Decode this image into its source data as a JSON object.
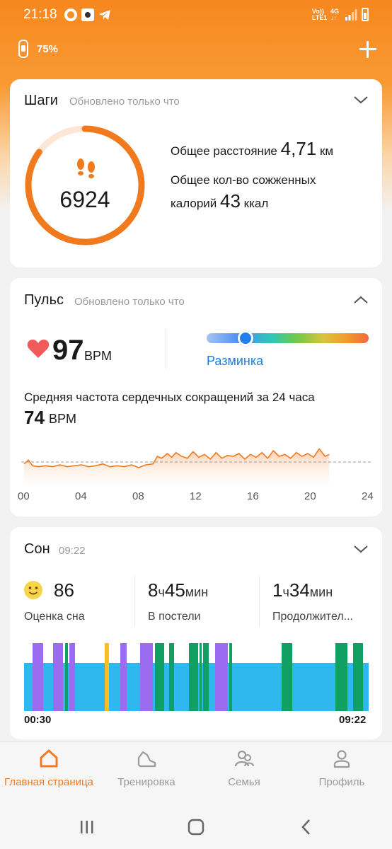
{
  "status_bar": {
    "time": "21:18",
    "net_top": "Vo))",
    "net_bottom": "LTE1",
    "g_top": "4G",
    "g_bottom": "↓↑"
  },
  "device": {
    "battery": "75%"
  },
  "steps": {
    "title": "Шаги",
    "updated": "Обновлено только что",
    "value": "6924",
    "progress": 0.85,
    "distance_label": "Общее расстояние",
    "distance_value": "4,71",
    "distance_unit": "км",
    "calories_label_line1": "Общее кол-во сожженных",
    "calories_label_line2": "калорий",
    "calories_value": "43",
    "calories_unit": "ккал"
  },
  "pulse": {
    "title": "Пульс",
    "updated": "Обновлено только что",
    "current_value": "97",
    "current_unit": "BPM",
    "zone_label": "Разминка",
    "zone_position": 0.24,
    "avg_label": "Средняя частота сердечных сокращений за 24 часа",
    "avg_value": "74",
    "avg_unit": "BPM",
    "x_ticks": [
      "00",
      "04",
      "08",
      "12",
      "16",
      "20",
      "24"
    ]
  },
  "chart_data": {
    "type": "area",
    "x_ticks": [
      "00",
      "04",
      "08",
      "12",
      "16",
      "20",
      "24"
    ],
    "xlim": [
      0,
      24
    ],
    "ylim": [
      50,
      110
    ],
    "reference_line": 74,
    "series": [
      {
        "color": "#f07a1d",
        "x": [
          0,
          0.3,
          0.6,
          1,
          1.5,
          2,
          2.5,
          3,
          3.5,
          4,
          4.5,
          5,
          5.5,
          6,
          6.5,
          7,
          7.5,
          8,
          8.5,
          9,
          9.3,
          9.6,
          10,
          10.3,
          10.6,
          11,
          11.4,
          11.8,
          12.2,
          12.6,
          13,
          13.4,
          13.8,
          14.2,
          14.6,
          15,
          15.4,
          15.8,
          16.2,
          16.6,
          17,
          17.4,
          17.8,
          18.2,
          18.6,
          19,
          19.4,
          19.8,
          20.2,
          20.6,
          21,
          21.3
        ],
        "y": [
          72,
          76,
          70,
          69,
          70,
          69,
          71,
          69,
          70,
          71,
          69,
          70,
          72,
          69,
          70,
          69,
          71,
          68,
          71,
          72,
          80,
          78,
          83,
          79,
          84,
          80,
          78,
          85,
          79,
          82,
          77,
          84,
          78,
          81,
          80,
          83,
          77,
          82,
          79,
          84,
          78,
          86,
          80,
          82,
          78,
          84,
          80,
          83,
          79,
          88,
          80,
          82
        ]
      }
    ]
  },
  "sleep": {
    "title": "Сон",
    "time": "09:22",
    "score": "86",
    "score_label": "Оценка сна",
    "bed_h": "8",
    "bed_h_unit": "ч",
    "bed_m": "45",
    "bed_m_unit": "мин",
    "bed_label": "В постели",
    "dur_h": "1",
    "dur_h_unit": "ч",
    "dur_m": "34",
    "dur_m_unit": "мин",
    "dur_label": "Продолжител...",
    "start": "00:30",
    "end": "09:22"
  },
  "nav": {
    "home": "Главная страница",
    "workout": "Тренировка",
    "family": "Семья",
    "profile": "Профиль"
  },
  "colors": {
    "accent": "#f37a20",
    "blue_sleep": "#2fb8ee",
    "purple_sleep": "#9b6bf0",
    "green_sleep": "#11a063",
    "yellow_sleep": "#f5c020",
    "link_blue": "#1e7fe2"
  }
}
